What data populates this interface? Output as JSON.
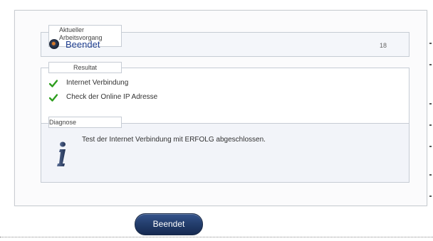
{
  "current": {
    "label": "Aktueller Arbeitsvorgang",
    "status": "Beendet",
    "count": "18"
  },
  "result": {
    "label": "Resultat",
    "items": [
      {
        "text": "Internet Verbindung"
      },
      {
        "text": "Check der Online IP Adresse"
      }
    ]
  },
  "diagnosis": {
    "label": "Diagnose",
    "message": "Test der Internet Verbindung mit ERFOLG abgeschlossen."
  },
  "footer": {
    "button_label": "Beendet"
  },
  "colors": {
    "accent": "#1e3d8f",
    "button": "#233d6c",
    "check": "#2e9e1e"
  }
}
